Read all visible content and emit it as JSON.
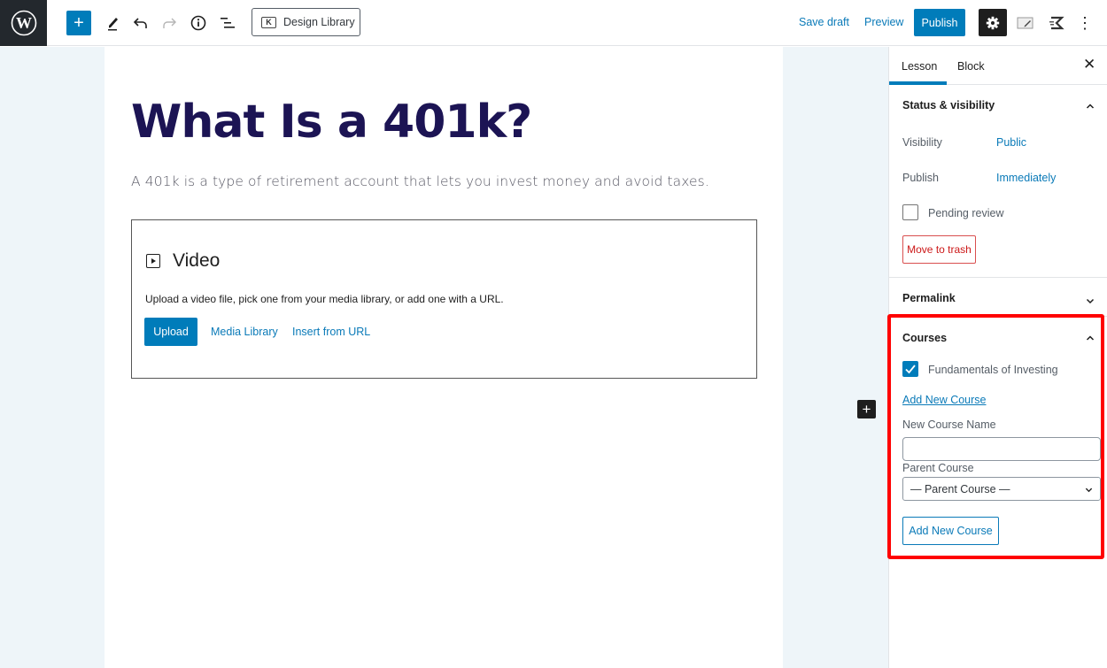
{
  "toolbar": {
    "logo_icon": "wordpress-logo-icon",
    "add_block_icon": "plus-icon",
    "tools_icon": "pencil-icon",
    "undo_icon": "undo-icon",
    "redo_icon": "redo-icon",
    "info_icon": "info-icon",
    "outline_icon": "list-view-icon",
    "design_library_label": "Design Library",
    "save_draft_label": "Save draft",
    "preview_label": "Preview",
    "publish_label": "Publish",
    "settings_icon": "gear-icon",
    "plus_sign": "+",
    "more_icon": "⋮"
  },
  "editor": {
    "title": "What Is a 401k?",
    "paragraph": "A 401k is a type of retirement account that lets you invest money and avoid taxes.",
    "video_block": {
      "title": "Video",
      "description": "Upload a video file, pick one from your media library, or add one with a URL.",
      "upload_label": "Upload",
      "media_library_label": "Media Library",
      "insert_url_label": "Insert from URL"
    },
    "inserter_label": "+"
  },
  "sidebar": {
    "tabs": [
      {
        "label": "Lesson",
        "active": true
      },
      {
        "label": "Block",
        "active": false
      }
    ],
    "close_label": "✕",
    "status_panel": {
      "title": "Status & visibility",
      "visibility_label": "Visibility",
      "visibility_value": "Public",
      "publish_label": "Publish",
      "publish_value": "Immediately",
      "pending_review_label": "Pending review",
      "pending_review_checked": false,
      "trash_label": "Move to trash"
    },
    "permalink_panel": {
      "title": "Permalink"
    },
    "courses_panel": {
      "title": "Courses",
      "courses": [
        {
          "label": "Fundamentals of Investing",
          "checked": true
        }
      ],
      "add_new_link": "Add New Course",
      "new_course_name_label": "New Course Name",
      "new_course_name_value": "",
      "parent_course_label": "Parent Course",
      "parent_course_selected": "— Parent Course —",
      "add_new_button": "Add New Course"
    }
  },
  "colors": {
    "accent": "#007cba",
    "title": "#1c1454",
    "highlight": "#ff0000",
    "danger": "#cc1818"
  }
}
